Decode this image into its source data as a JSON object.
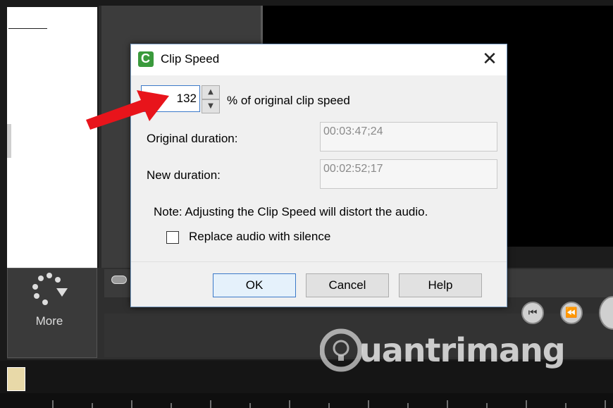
{
  "background": {
    "more_label": "More",
    "watermark_text": "uantrimang"
  },
  "dialog": {
    "title": "Clip Speed",
    "close_glyph": "✕",
    "speed_value": "132",
    "speed_suffix": "% of original clip speed",
    "original_duration_label": "Original duration:",
    "original_duration_value": "00:03:47;24",
    "new_duration_label": "New duration:",
    "new_duration_value": "00:02:52;17",
    "note": "Note: Adjusting the Clip Speed will distort the audio.",
    "replace_audio_label": "Replace audio with silence",
    "replace_audio_checked": false,
    "ok_label": "OK",
    "cancel_label": "Cancel",
    "help_label": "Help"
  },
  "icons": {
    "app": "camtasia-icon",
    "spin_up": "arrow-up-icon",
    "spin_down": "arrow-down-icon",
    "annotation": "red-arrow"
  },
  "colors": {
    "accent": "#3b79c9",
    "app_icon": "#3a9a3c",
    "annotation_arrow": "#e8141b"
  }
}
